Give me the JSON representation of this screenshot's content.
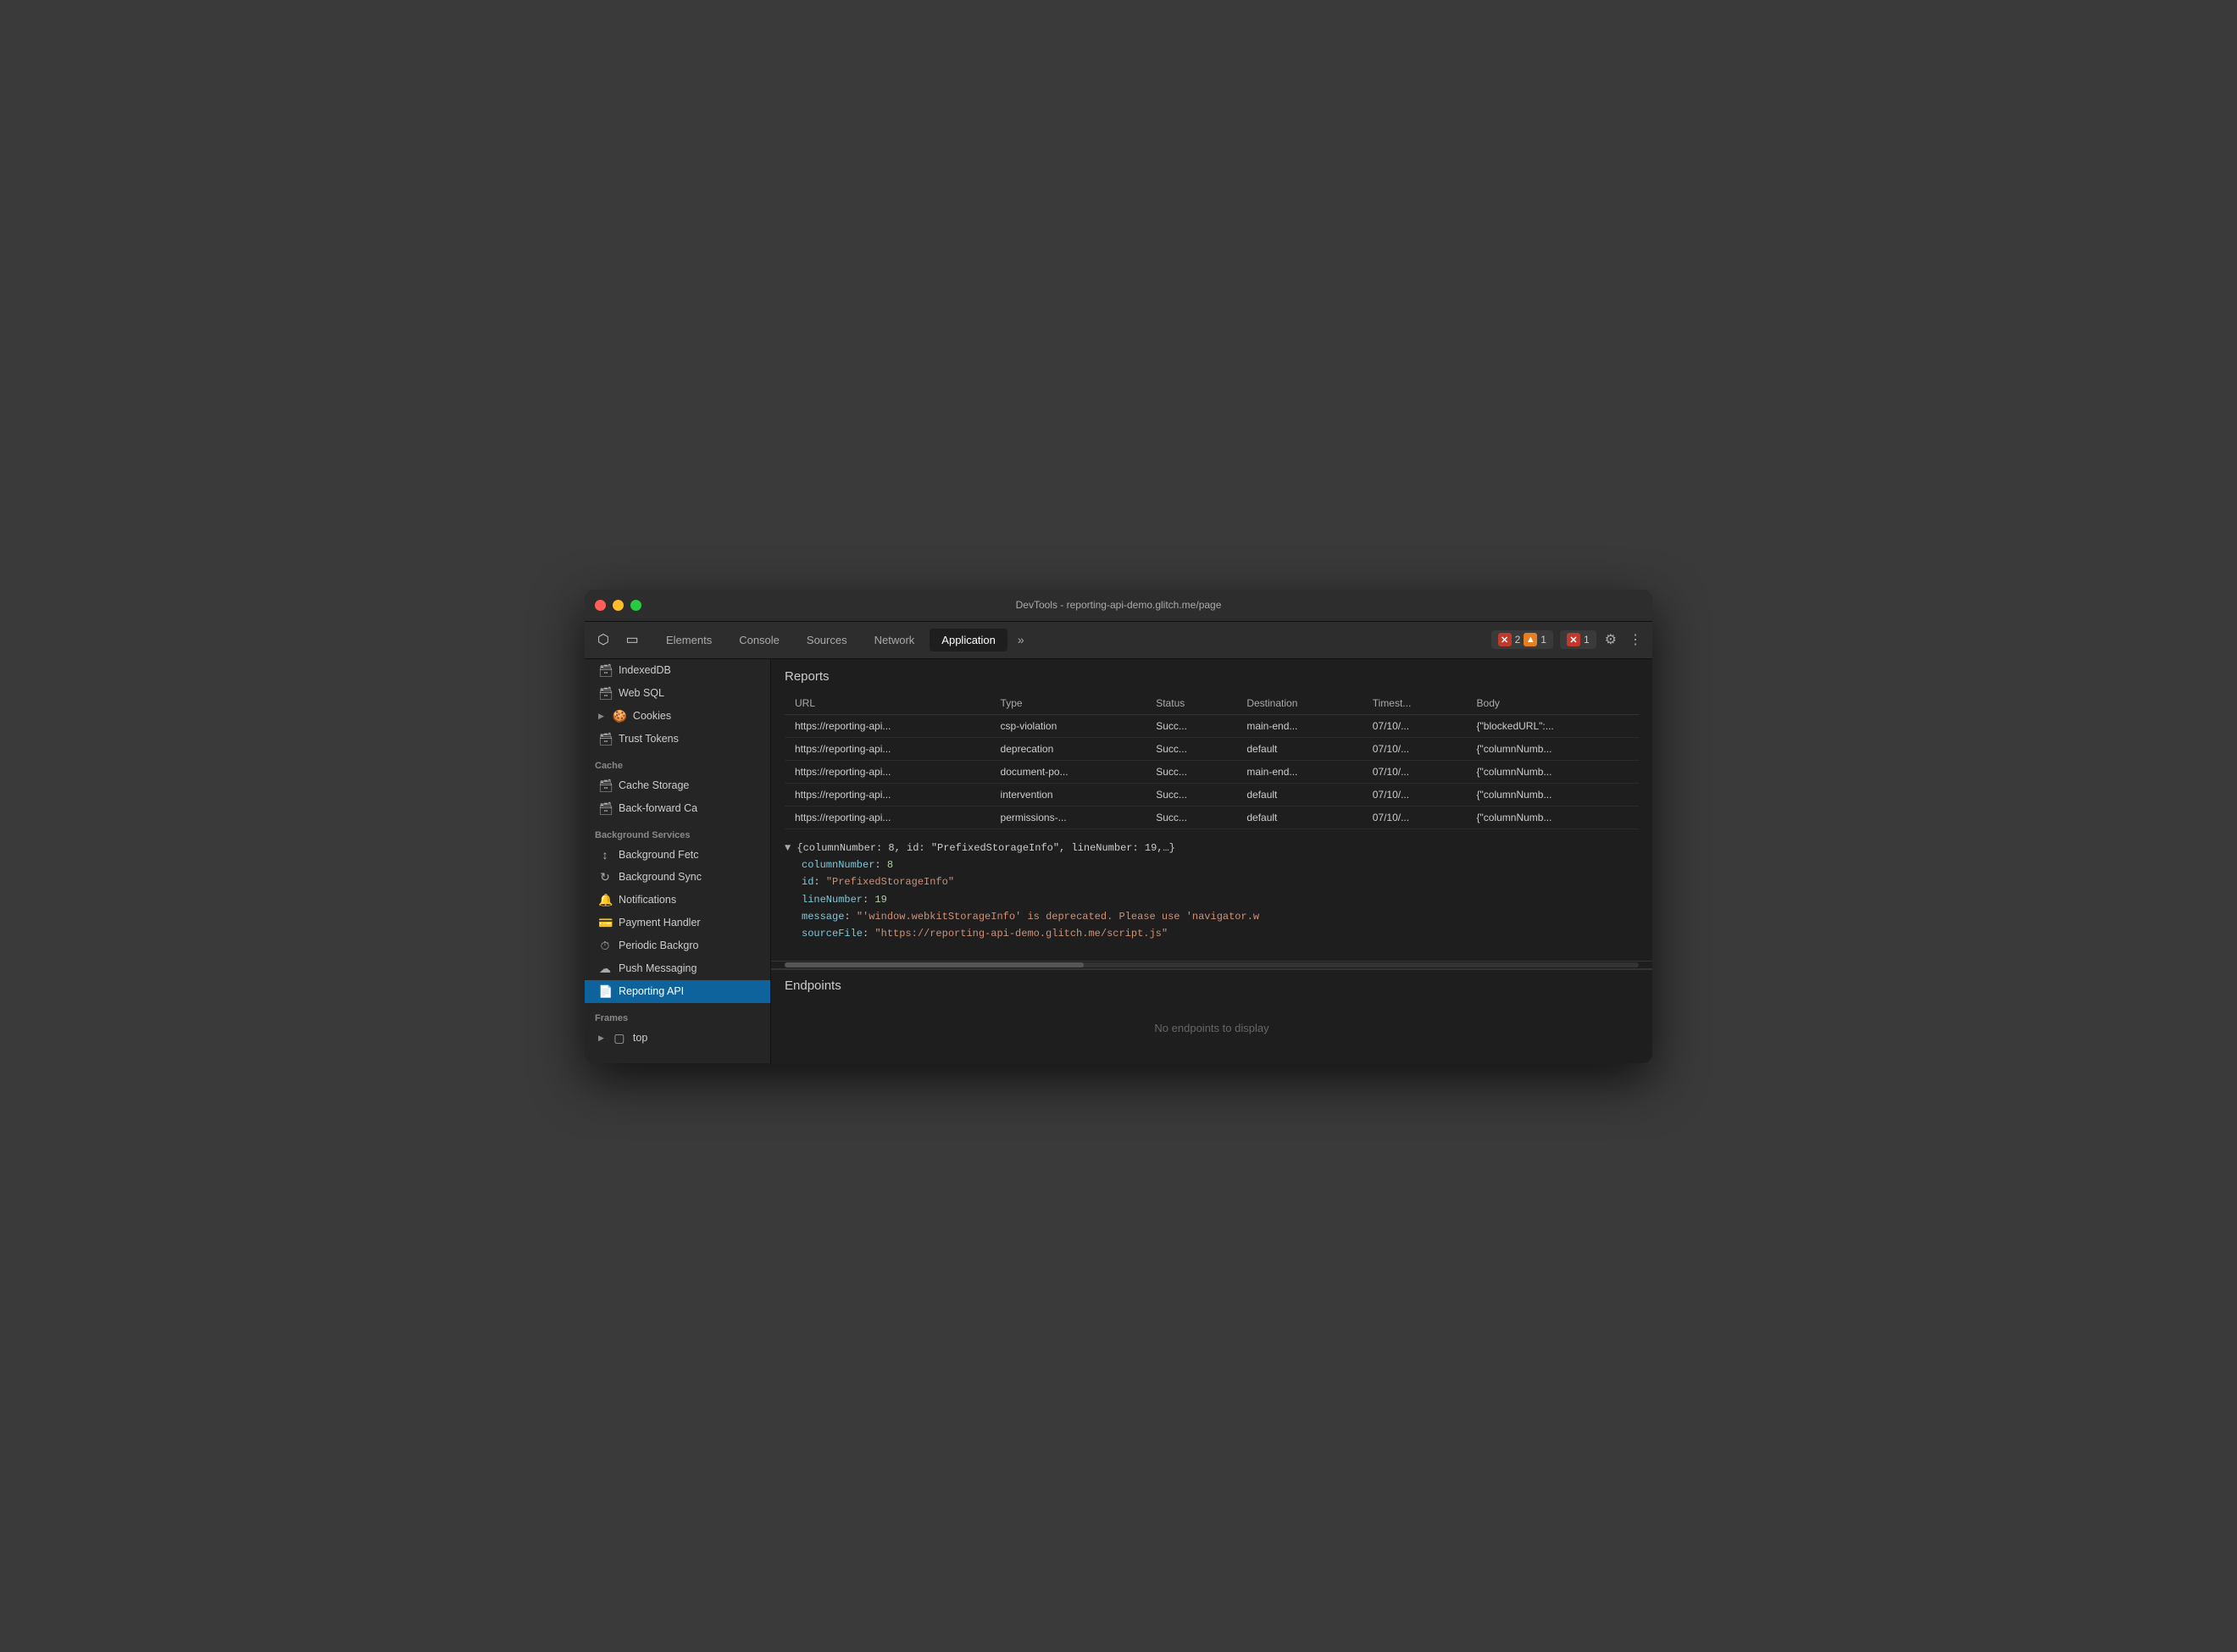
{
  "window": {
    "title": "DevTools - reporting-api-demo.glitch.me/page"
  },
  "toolbar": {
    "tabs": [
      {
        "id": "elements",
        "label": "Elements",
        "active": false
      },
      {
        "id": "console",
        "label": "Console",
        "active": false
      },
      {
        "id": "sources",
        "label": "Sources",
        "active": false
      },
      {
        "id": "network",
        "label": "Network",
        "active": false
      },
      {
        "id": "application",
        "label": "Application",
        "active": true
      }
    ],
    "more_label": "»",
    "errors_count": "2",
    "warnings_count": "1",
    "violations_count": "1"
  },
  "sidebar": {
    "sections": [
      {
        "items": [
          {
            "id": "indexeddb",
            "icon": "🗃",
            "label": "IndexedDB",
            "hasArrow": false
          },
          {
            "id": "websql",
            "icon": "🗃",
            "label": "Web SQL",
            "hasArrow": false
          },
          {
            "id": "cookies",
            "icon": "🍪",
            "label": "Cookies",
            "hasArrow": true
          },
          {
            "id": "trusttokens",
            "icon": "🗃",
            "label": "Trust Tokens",
            "hasArrow": false
          }
        ]
      },
      {
        "label": "Cache",
        "items": [
          {
            "id": "cachestorage",
            "icon": "🗃",
            "label": "Cache Storage",
            "hasArrow": false
          },
          {
            "id": "backforward",
            "icon": "🗃",
            "label": "Back-forward Ca",
            "hasArrow": false
          }
        ]
      },
      {
        "label": "Background Services",
        "items": [
          {
            "id": "bgfetch",
            "icon": "↕",
            "label": "Background Fetc",
            "hasArrow": false
          },
          {
            "id": "bgsync",
            "icon": "↻",
            "label": "Background Sync",
            "hasArrow": false
          },
          {
            "id": "notifications",
            "icon": "🔔",
            "label": "Notifications",
            "hasArrow": false
          },
          {
            "id": "paymenthandler",
            "icon": "💳",
            "label": "Payment Handler",
            "hasArrow": false
          },
          {
            "id": "periodicbg",
            "icon": "⏱",
            "label": "Periodic Backgro",
            "hasArrow": false
          },
          {
            "id": "pushmessaging",
            "icon": "☁",
            "label": "Push Messaging",
            "hasArrow": false
          },
          {
            "id": "reportingapi",
            "icon": "📄",
            "label": "Reporting API",
            "active": true,
            "hasArrow": false
          }
        ]
      },
      {
        "label": "Frames",
        "items": [
          {
            "id": "top",
            "icon": "▢",
            "label": "top",
            "hasArrow": true
          }
        ]
      }
    ]
  },
  "reports": {
    "title": "Reports",
    "columns": [
      "URL",
      "Type",
      "Status",
      "Destination",
      "Timest...",
      "Body"
    ],
    "rows": [
      {
        "url": "https://reporting-api...",
        "type": "csp-violation",
        "status": "Succ...",
        "destination": "main-end...",
        "timestamp": "07/10/...",
        "body": "{\"blockedURL\":..."
      },
      {
        "url": "https://reporting-api...",
        "type": "deprecation",
        "status": "Succ...",
        "destination": "default",
        "timestamp": "07/10/...",
        "body": "{\"columnNumb..."
      },
      {
        "url": "https://reporting-api...",
        "type": "document-po...",
        "status": "Succ...",
        "destination": "main-end...",
        "timestamp": "07/10/...",
        "body": "{\"columnNumb..."
      },
      {
        "url": "https://reporting-api...",
        "type": "intervention",
        "status": "Succ...",
        "destination": "default",
        "timestamp": "07/10/...",
        "body": "{\"columnNumb..."
      },
      {
        "url": "https://reporting-api...",
        "type": "permissions-...",
        "status": "Succ...",
        "destination": "default",
        "timestamp": "07/10/...",
        "body": "{\"columnNumb..."
      }
    ]
  },
  "json_detail": {
    "header": "{columnNumber: 8, id: \"PrefixedStorageInfo\", lineNumber: 19,…}",
    "fields": [
      {
        "key": "columnNumber",
        "value": "8",
        "type": "number"
      },
      {
        "key": "id",
        "value": "\"PrefixedStorageInfo\"",
        "type": "string"
      },
      {
        "key": "lineNumber",
        "value": "19",
        "type": "number"
      },
      {
        "key": "message",
        "value": "\"'window.webkitStorageInfo' is deprecated. Please use 'navigator.w",
        "type": "string"
      },
      {
        "key": "sourceFile",
        "value": "\"https://reporting-api-demo.glitch.me/script.js\"",
        "type": "string"
      }
    ]
  },
  "endpoints": {
    "title": "Endpoints",
    "empty_message": "No endpoints to display"
  }
}
